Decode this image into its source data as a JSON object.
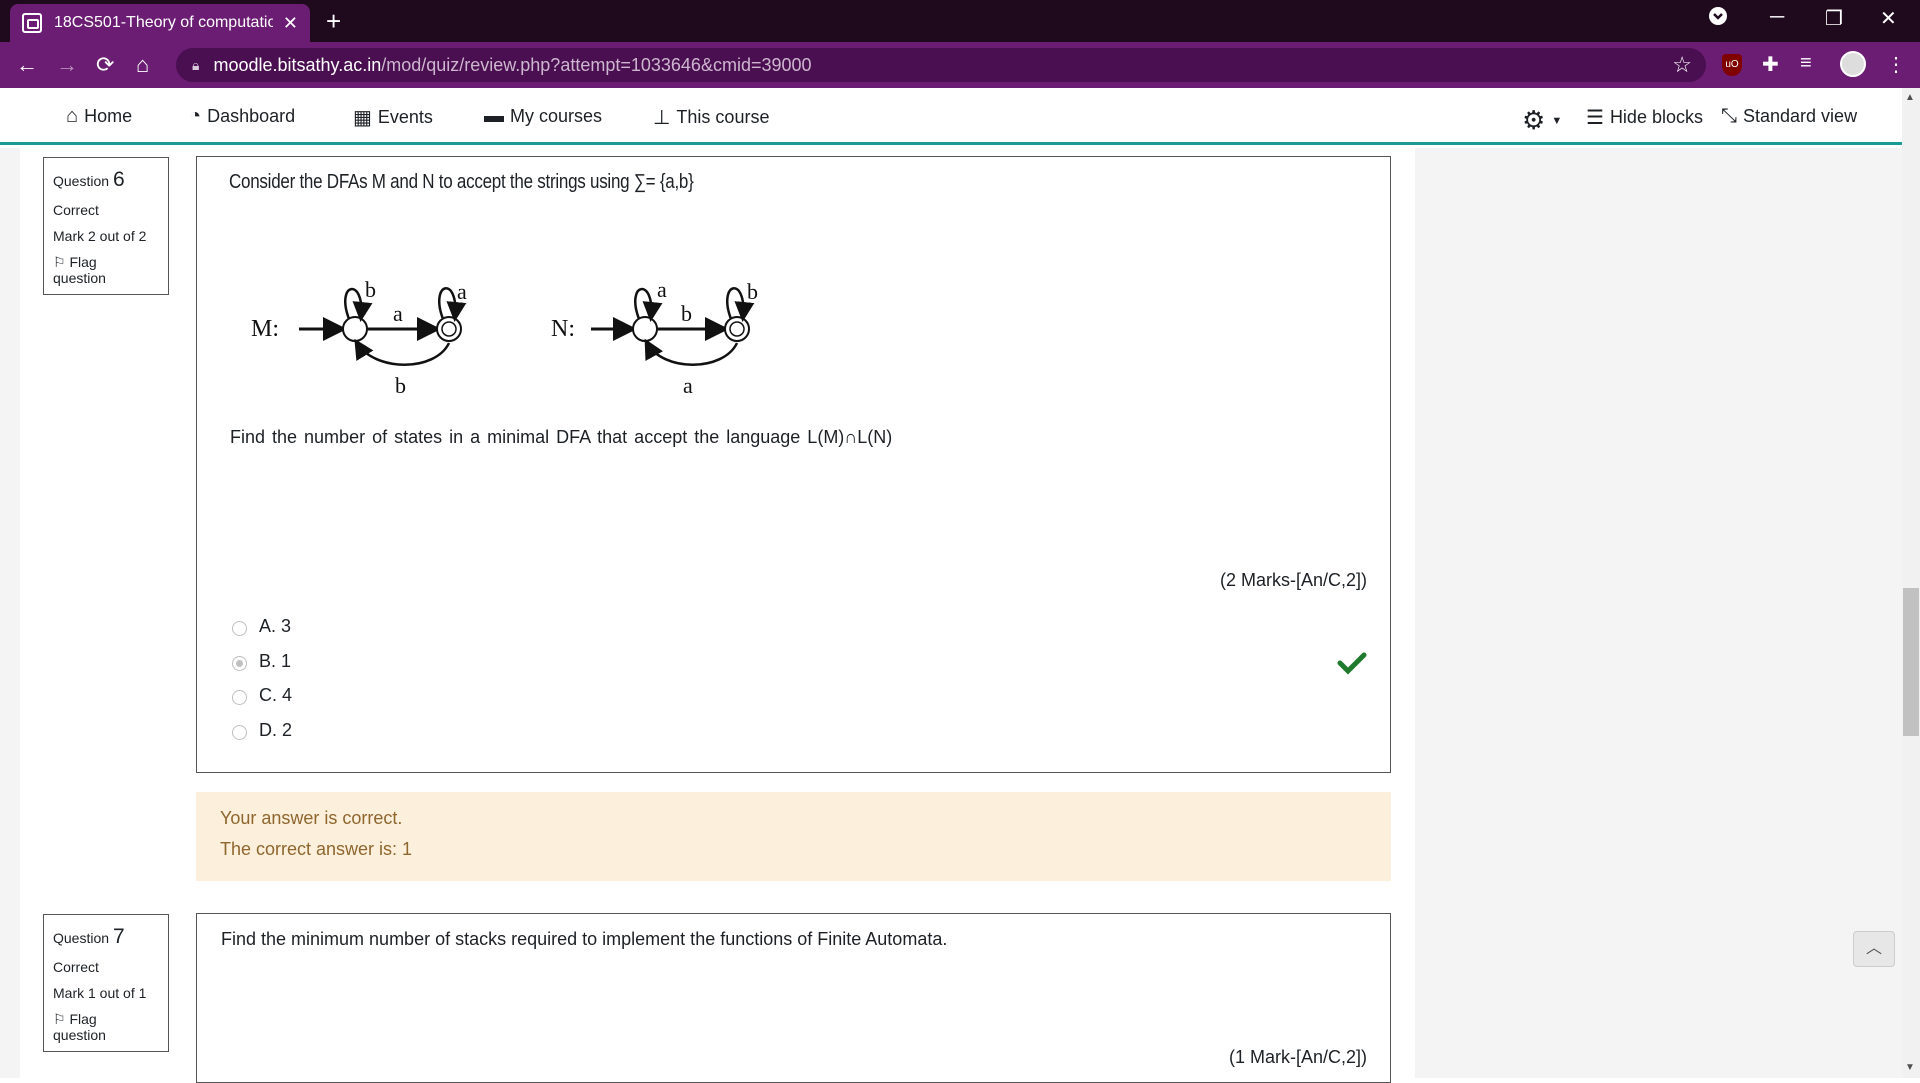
{
  "browser": {
    "tab_title": "18CS501-Theory of computation",
    "tab_close": "✕",
    "new_tab": "+",
    "url_host": "moodle.bitsathy.ac.in",
    "url_path": "/mod/quiz/review.php?attempt=1033646&cmid=39000",
    "ublock_label": "uO"
  },
  "navbar": {
    "items": [
      {
        "label": "Home",
        "icon": "home-icon"
      },
      {
        "label": "Dashboard",
        "icon": "dashboard-icon"
      },
      {
        "label": "Events",
        "icon": "calendar-icon"
      },
      {
        "label": "My courses",
        "icon": "briefcase-icon"
      },
      {
        "label": "This course",
        "icon": "sitemap-icon"
      }
    ],
    "hide_blocks": "Hide blocks",
    "standard_view": "Standard view"
  },
  "question6": {
    "label": "Question",
    "number": "6",
    "status": "Correct",
    "mark": "Mark 2 out of 2",
    "flag": "Flag",
    "flag2": "question",
    "title": "Consider the DFAs  M and N to accept the strings using ∑= {a,b}",
    "diagram": {
      "m_label": "M:",
      "n_label": "N:",
      "m_loop1": "b",
      "m_loop2": "a",
      "m_edge_top": "a",
      "m_edge_bottom": "b",
      "n_loop1": "a",
      "n_loop2": "b",
      "n_edge_top": "b",
      "n_edge_bottom": "a"
    },
    "find_text": "Find the number of states in a minimal DFA that accept the language  L(M)∩L(N)",
    "marks": "(2 Marks-[An/C,2])",
    "options": [
      "A. 3",
      "B. 1",
      "C. 4",
      "D. 2"
    ],
    "selected_index": 1,
    "feedback_1": "Your answer is correct.",
    "feedback_2": "The correct answer is: 1"
  },
  "question7": {
    "label": "Question",
    "number": "7",
    "status": "Correct",
    "mark": "Mark 1 out of 1",
    "flag": "Flag",
    "flag2": "question",
    "text": "Find the minimum number of stacks required to implement the functions of Finite Automata.",
    "marks": "(1 Mark-[An/C,2])"
  },
  "colors": {
    "chrome_dark": "#1f0a1d",
    "chrome_purple": "#6b1d73",
    "accent_teal": "#1a9c94",
    "feedback_bg": "#fcefdc",
    "feedback_text": "#8e662e",
    "correct_green": "#1f7a2e"
  }
}
